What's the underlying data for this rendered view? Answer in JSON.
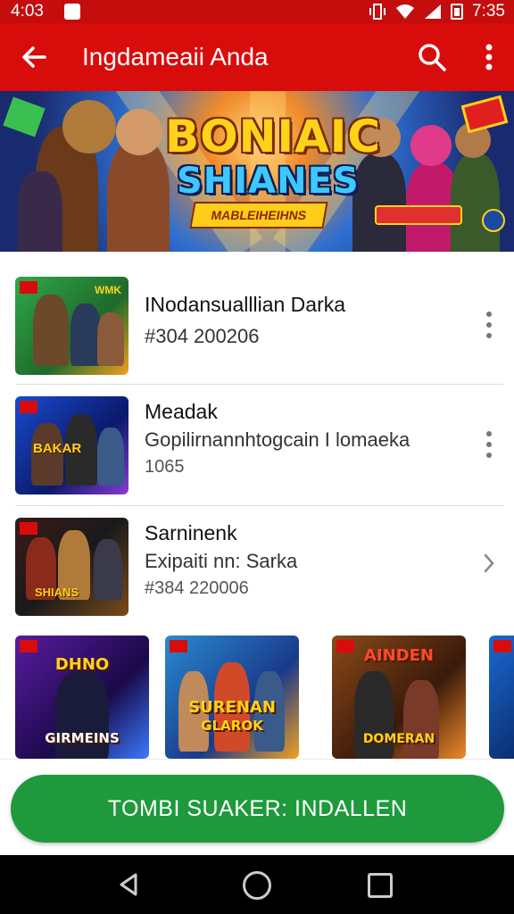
{
  "status_bar": {
    "time_left": "4:03",
    "time_right": "7:35"
  },
  "app_bar": {
    "title": "Ingdameaii Anda"
  },
  "banner": {
    "title_line1": "BONIAIC",
    "title_line2": "SHIANES",
    "ribbon_text": "MABLEIHEIHNS"
  },
  "apps": [
    {
      "name": "INodansualllian Darka",
      "line1": "#304 200206",
      "line2": "",
      "thumb_label": "WMK"
    },
    {
      "name": "Meadak",
      "line1": "Gopilirnannhtogcain I lomaeka",
      "line2": "1065",
      "thumb_label": "BAKAR"
    },
    {
      "name": "Sarninenk",
      "line1": "Exipaiti nn: Sarka",
      "line2": "#384 220006",
      "thumb_label": "SHIANS"
    }
  ],
  "tiles": [
    {
      "top_label": "DHNO",
      "bottom_label": "GIRMEINS"
    },
    {
      "top_label": "SURENAN",
      "bottom_label": "GLAROK"
    },
    {
      "top_label": "AINDEN",
      "bottom_label": "DOMERAN"
    }
  ],
  "install_button": {
    "label": "TOMBI SUAKER: INDALLEN"
  },
  "colors": {
    "primary": "#d90c0c",
    "status": "#c40d0d",
    "install": "#1e9a3c"
  }
}
